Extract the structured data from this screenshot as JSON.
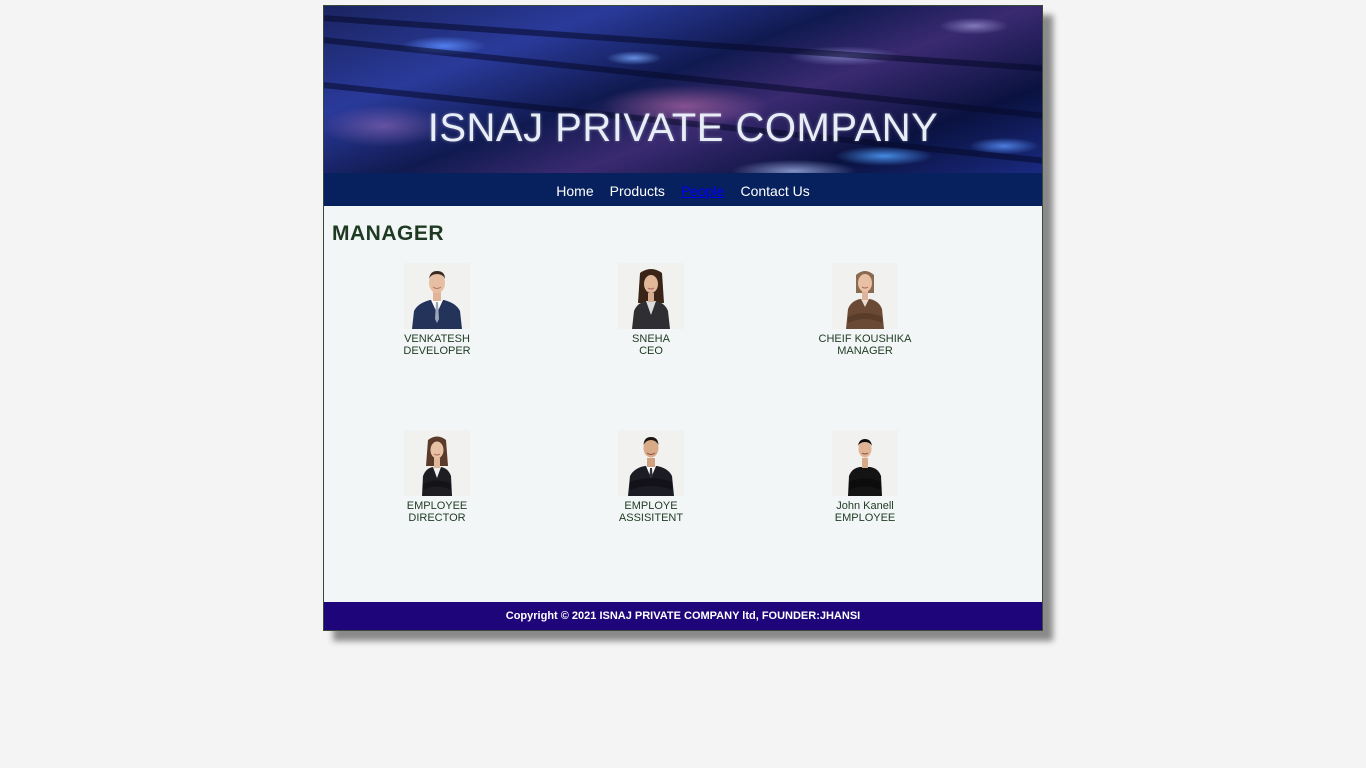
{
  "header": {
    "title": "ISNAJ PRIVATE COMPANY"
  },
  "nav": {
    "items": [
      {
        "label": "Home",
        "active": false
      },
      {
        "label": "Products",
        "active": false
      },
      {
        "label": "People",
        "active": true
      },
      {
        "label": "Contact Us",
        "active": false
      }
    ]
  },
  "main": {
    "heading": "MANAGER",
    "people": [
      {
        "name": "VENKATESH",
        "role": "DEVELOPER",
        "photo": "man-in-suit-portrait"
      },
      {
        "name": "SNEHA",
        "role": "CEO",
        "photo": "woman-in-suit-portrait"
      },
      {
        "name": "CHEIF KOUSHIKA",
        "role": "MANAGER",
        "photo": "woman-arms-crossed-portrait"
      },
      {
        "name": "EMPLOYEE",
        "role": "DIRECTOR",
        "photo": "woman-arms-crossed-portrait"
      },
      {
        "name": "EMPLOYE",
        "role": "ASSISITENT",
        "photo": "man-arms-crossed-portrait"
      },
      {
        "name": "John Kanell",
        "role": "EMPLOYEE",
        "photo": "man-arms-crossed-portrait"
      }
    ]
  },
  "footer": {
    "text": "Copyright © 2021 ISNAJ PRIVATE COMPANY ltd, FOUNDER:JHANSI"
  },
  "colors": {
    "nav_bg": "#07215e",
    "footer_bg": "#1e067a",
    "heading": "#1f3a22",
    "active_link": "#0000ee"
  }
}
